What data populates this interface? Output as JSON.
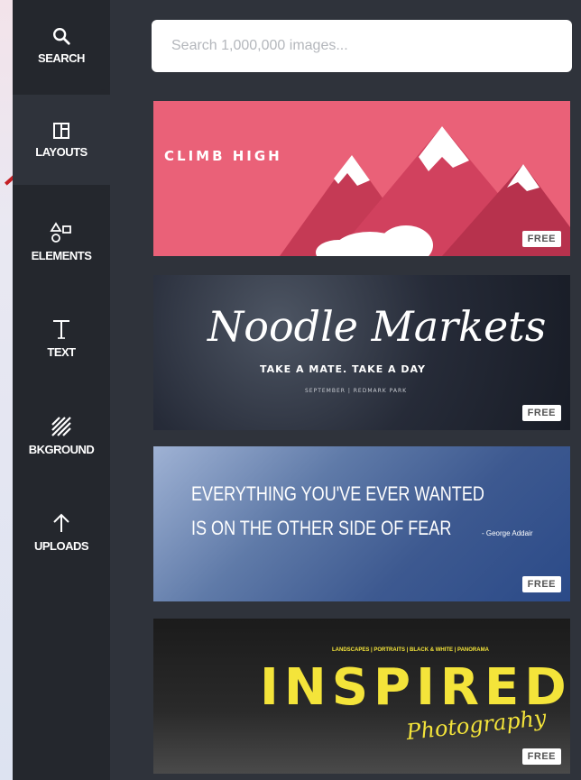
{
  "sidebar": {
    "items": [
      {
        "label": "SEARCH",
        "icon": "search-icon"
      },
      {
        "label": "LAYOUTS",
        "icon": "layouts-icon"
      },
      {
        "label": "ELEMENTS",
        "icon": "elements-icon"
      },
      {
        "label": "TEXT",
        "icon": "text-icon"
      },
      {
        "label": "BKGROUND",
        "icon": "background-icon"
      },
      {
        "label": "UPLOADS",
        "icon": "upload-icon"
      }
    ]
  },
  "search": {
    "placeholder": "Search 1,000,000 images..."
  },
  "cards": [
    {
      "title": "CLIMB HIGH",
      "badge": "FREE"
    },
    {
      "title": "Noodle Markets",
      "subtitle": "TAKE A MATE. TAKE A DAY",
      "details": "SEPTEMBER | REDMARK PARK",
      "badge": "FREE"
    },
    {
      "line1": "EVERYTHING YOU'VE EVER WANTED",
      "line2": "IS ON THE OTHER SIDE OF FEAR",
      "author": "- George Addair",
      "badge": "FREE"
    },
    {
      "tagline": "LANDSCAPES | PORTRAITS | BLACK & WHITE | PANORAMA",
      "title": "INSPIRED",
      "subtitle": "Photography",
      "badge": "FREE"
    }
  ],
  "colors": {
    "rail": "#24272d",
    "panel": "#2f333b",
    "card_pink": "#ea6178",
    "accent_yellow": "#f4e43a",
    "arrow_red": "#c41f24"
  }
}
